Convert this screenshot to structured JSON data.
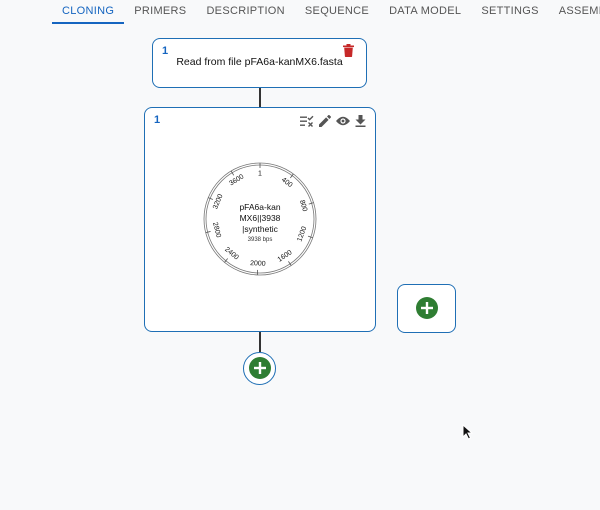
{
  "tabs": [
    {
      "label": "CLONING",
      "active": true
    },
    {
      "label": "PRIMERS",
      "active": false
    },
    {
      "label": "DESCRIPTION",
      "active": false
    },
    {
      "label": "SEQUENCE",
      "active": false
    },
    {
      "label": "DATA MODEL",
      "active": false
    },
    {
      "label": "SETTINGS",
      "active": false
    },
    {
      "label": "ASSEMBLER",
      "active": false
    }
  ],
  "source_node": {
    "id": "1",
    "text": "Read from file pFA6a-kanMX6.fasta",
    "delete_icon": "trash-icon"
  },
  "sequence_node": {
    "id": "1",
    "icons": [
      "checklist-icon",
      "edit-icon",
      "eye-icon",
      "download-icon"
    ],
    "plasmid": {
      "name_lines": [
        "pFA6a-kan",
        "MX6||3938",
        "|synthetic"
      ],
      "length_label": "3938 bps",
      "length": 3938,
      "ticks": [
        1,
        400,
        800,
        1200,
        1600,
        2000,
        2400,
        2800,
        3200,
        3600
      ]
    }
  },
  "add_buttons": {
    "below_sequence": "add-icon",
    "side": "add-icon"
  },
  "colors": {
    "accent": "#1565c0",
    "node_border": "#1f6fb5",
    "add_green": "#2e7d32",
    "delete_red": "#c62828"
  }
}
